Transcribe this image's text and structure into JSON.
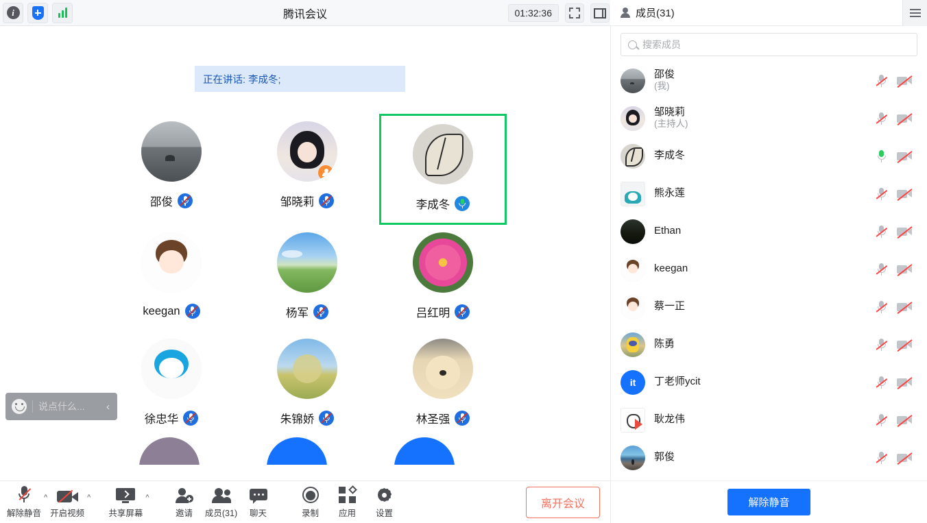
{
  "titlebar": {
    "app_title": "腾讯会议",
    "timer": "01:32:36",
    "left_icons": [
      {
        "name": "info-icon",
        "glyph": "i"
      },
      {
        "name": "security-shield-icon",
        "glyph": "+"
      },
      {
        "name": "network-signal-icon",
        "glyph": "bars"
      }
    ],
    "window_controls": [
      {
        "name": "exit-fullscreen-icon"
      },
      {
        "name": "layout-toggle-icon"
      }
    ]
  },
  "stage": {
    "speaking_banner": "正在讲话: 李成冬;",
    "chat_input": {
      "placeholder": "说点什么...",
      "emoji_label": "☺",
      "collapse_label": "‹"
    },
    "tiles": [
      {
        "name": "邵俊",
        "art": "a-lake",
        "muted": true,
        "active": false,
        "badge": false
      },
      {
        "name": "邹晓莉",
        "art": "a-girl",
        "muted": true,
        "active": false,
        "badge": true
      },
      {
        "name": "李成冬",
        "art": "a-leaf",
        "muted": false,
        "active": true,
        "badge": false
      },
      {
        "name": "keegan",
        "art": "a-anime",
        "muted": true,
        "active": false,
        "badge": false
      },
      {
        "name": "杨军",
        "art": "a-field",
        "muted": true,
        "active": false,
        "badge": false
      },
      {
        "name": "吕红明",
        "art": "a-flower",
        "muted": true,
        "active": false,
        "badge": false
      },
      {
        "name": "徐忠华",
        "art": "a-doraemon",
        "muted": true,
        "active": false,
        "badge": false
      },
      {
        "name": "朱锦娇",
        "art": "a-tree",
        "muted": true,
        "active": false,
        "badge": false
      },
      {
        "name": "林圣强",
        "art": "a-dog",
        "muted": true,
        "active": false,
        "badge": false
      }
    ],
    "partial_row": [
      {
        "art": "a-girl"
      },
      {
        "art": "a-initial-blue"
      },
      {
        "art": "a-initial-blue"
      }
    ]
  },
  "sidebar": {
    "header_title": "成员(31)",
    "header_icon": "person-icon",
    "menu_icon": "hamburger-icon",
    "search": {
      "placeholder": "搜索成员",
      "value": ""
    },
    "unmute_all_label": "解除静音",
    "participants": [
      {
        "name": "邵俊",
        "role": "(我)",
        "art": "a-lake",
        "initial": "",
        "mic_muted": true,
        "cam_off": true,
        "shape": "circle"
      },
      {
        "name": "邹晓莉",
        "role": "(主持人)",
        "art": "a-girl",
        "initial": "",
        "mic_muted": true,
        "cam_off": true,
        "shape": "circle"
      },
      {
        "name": "李成冬",
        "role": "",
        "art": "a-leaf",
        "initial": "",
        "mic_muted": false,
        "cam_off": true,
        "shape": "circle"
      },
      {
        "name": "熊永莲",
        "role": "",
        "art": "a-kawaii",
        "initial": "",
        "mic_muted": true,
        "cam_off": true,
        "shape": "square"
      },
      {
        "name": "Ethan",
        "role": "",
        "art": "a-dark",
        "initial": "",
        "mic_muted": true,
        "cam_off": true,
        "shape": "circle"
      },
      {
        "name": "keegan",
        "role": "",
        "art": "a-anime",
        "initial": "",
        "mic_muted": true,
        "cam_off": true,
        "shape": "circle"
      },
      {
        "name": "蔡一正",
        "role": "",
        "art": "a-anime",
        "initial": "",
        "mic_muted": true,
        "cam_off": true,
        "shape": "circle"
      },
      {
        "name": "陈勇",
        "role": "",
        "art": "a-minion",
        "initial": "",
        "mic_muted": true,
        "cam_off": true,
        "shape": "circle"
      },
      {
        "name": "丁老师ycit",
        "role": "",
        "art": "a-initial",
        "initial": "it",
        "mic_muted": true,
        "cam_off": true,
        "shape": "circle"
      },
      {
        "name": "耿龙伟",
        "role": "",
        "art": "a-line",
        "initial": "",
        "mic_muted": true,
        "cam_off": true,
        "shape": "square"
      },
      {
        "name": "郭俊",
        "role": "",
        "art": "a-sea",
        "initial": "",
        "mic_muted": true,
        "cam_off": true,
        "shape": "circle"
      }
    ]
  },
  "toolbar": {
    "items": [
      {
        "label": "解除静音",
        "icon": "mic-muted-icon",
        "caret": true
      },
      {
        "label": "开启视频",
        "icon": "camera-off-icon",
        "caret": true
      },
      {
        "label": "共享屏幕",
        "icon": "share-screen-icon",
        "caret": true
      },
      {
        "label": "邀请",
        "icon": "invite-icon",
        "caret": false
      },
      {
        "label": "成员(31)",
        "icon": "members-icon",
        "caret": false
      },
      {
        "label": "聊天",
        "icon": "chat-icon",
        "caret": false
      },
      {
        "label": "录制",
        "icon": "record-icon",
        "caret": false
      },
      {
        "label": "应用",
        "icon": "apps-icon",
        "caret": false
      },
      {
        "label": "设置",
        "icon": "settings-gear-icon",
        "caret": false
      }
    ],
    "leave_label": "离开会议"
  },
  "colors": {
    "accent_blue": "#1472ff",
    "active_green": "#0ec963",
    "leave_red": "#f4705f",
    "banner_bg": "#dbe9fb",
    "banner_text": "#1a56b8",
    "mute_red": "#ff4242"
  }
}
